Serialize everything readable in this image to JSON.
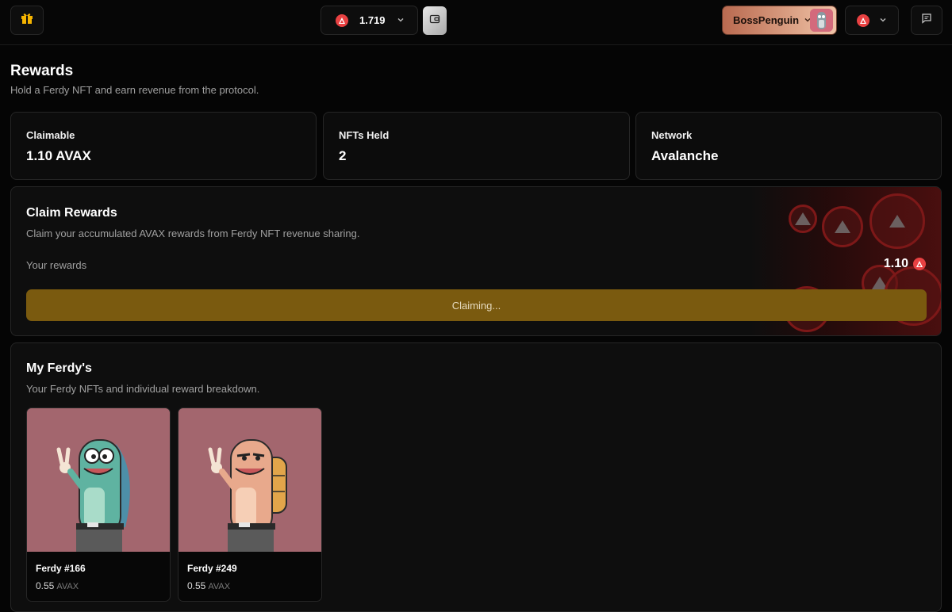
{
  "header": {
    "balance": "1.719",
    "username": "BossPenguin"
  },
  "page": {
    "title": "Rewards",
    "subtitle": "Hold a Ferdy NFT and earn revenue from the protocol."
  },
  "stats": [
    {
      "label": "Claimable",
      "value": "1.10 AVAX"
    },
    {
      "label": "NFTs Held",
      "value": "2"
    },
    {
      "label": "Network",
      "value": "Avalanche"
    }
  ],
  "claim": {
    "title": "Claim Rewards",
    "subtitle": "Claim your accumulated AVAX rewards from Ferdy NFT revenue sharing.",
    "your_rewards_label": "Your rewards",
    "your_rewards_value": "1.10",
    "button_label": "Claiming..."
  },
  "ferdys": {
    "title": "My Ferdy's",
    "subtitle": "Your Ferdy NFTs and individual reward breakdown.",
    "items": [
      {
        "name": "Ferdy #166",
        "reward": "0.55",
        "unit": "AVAX",
        "body_color": "#5fb3a1"
      },
      {
        "name": "Ferdy #249",
        "reward": "0.55",
        "unit": "AVAX",
        "body_color": "#e8a98c"
      }
    ]
  },
  "colors": {
    "accent_gold": "#7a5a0f",
    "avax_red": "#e84142",
    "nft_bg": "#a3666e"
  }
}
